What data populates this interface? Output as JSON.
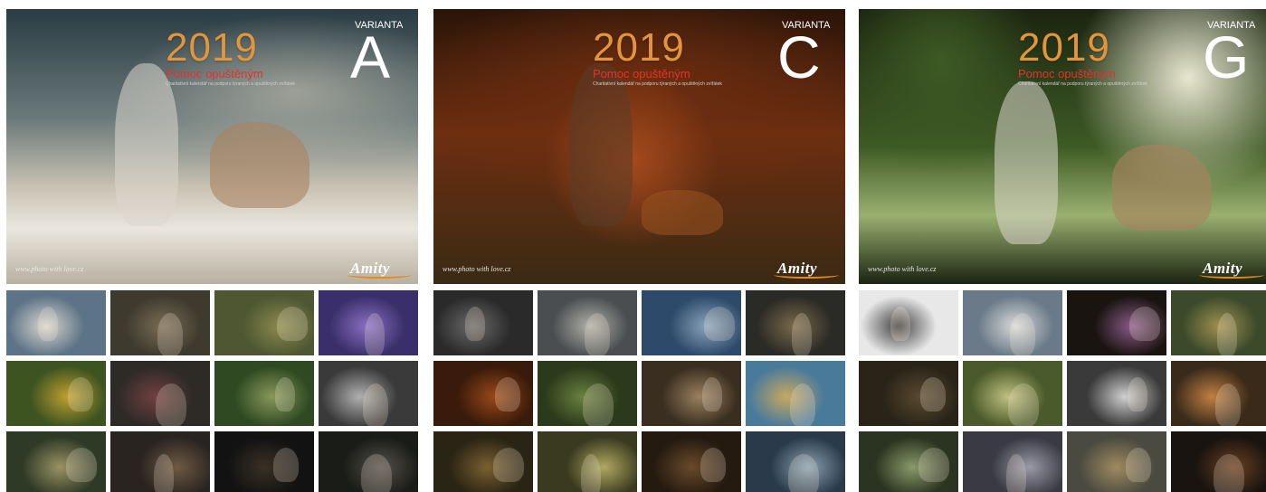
{
  "panels": [
    {
      "id": "a",
      "year": "2019",
      "subtitle": "Pomoc opuštěným",
      "tagline": "Charitativní kalendář na podporu týraných a opuštěných zvířátek",
      "variant_label": "VARIANTA",
      "variant_letter": "A",
      "signature": "www.photo with love.cz",
      "logo": "Amity",
      "cover_colors": [
        "#2a3c44",
        "#6b7a7a",
        "#c9c3b4",
        "#eae6de"
      ],
      "thumb_colors": [
        [
          "#5d7488",
          "#d9d6cc"
        ],
        [
          "#3e3a2e",
          "#7a6d55"
        ],
        [
          "#4e5732",
          "#8c8a4e"
        ],
        [
          "#3a2f6a",
          "#8a6fc2"
        ],
        [
          "#3e5420",
          "#c0a030"
        ],
        [
          "#2e2a26",
          "#704040"
        ],
        [
          "#2f4a22",
          "#88985a"
        ],
        [
          "#3a3a3a",
          "#b0b0b0"
        ],
        [
          "#2e3a26",
          "#9a9264"
        ],
        [
          "#2a2420",
          "#6e5a44"
        ],
        [
          "#121212",
          "#3a3024"
        ],
        [
          "#1a1c18",
          "#55504a"
        ]
      ]
    },
    {
      "id": "c",
      "year": "2019",
      "subtitle": "Pomoc opuštěným",
      "tagline": "Charitativní kalendář na podporu týraných a opuštěných zvířátek",
      "variant_label": "VARIANTA",
      "variant_letter": "C",
      "signature": "www.photo with love.cz",
      "logo": "Amity",
      "cover_colors": [
        "#2a1408",
        "#6e2e10",
        "#a44a1c",
        "#3a2a14"
      ],
      "thumb_colors": [
        [
          "#2a2a2a",
          "#6a6a6a"
        ],
        [
          "#4a4e50",
          "#b0b0a8"
        ],
        [
          "#2e4a6a",
          "#8aa4bc"
        ],
        [
          "#2a2a26",
          "#7a6a4a"
        ],
        [
          "#3a1a0a",
          "#9a4a1a"
        ],
        [
          "#2a3a1a",
          "#6a8040"
        ],
        [
          "#3a2e20",
          "#9a8060"
        ],
        [
          "#4a7a9a",
          "#c8a860"
        ],
        [
          "#2a2414",
          "#7a6030"
        ],
        [
          "#3a3a20",
          "#b0a860"
        ],
        [
          "#241a10",
          "#6a4a2a"
        ],
        [
          "#2a3a4a",
          "#8aa0b0"
        ]
      ]
    },
    {
      "id": "g",
      "year": "2019",
      "subtitle": "Pomoc opuštěným",
      "tagline": "Charitativní kalendář na podporu týraných a opuštěných zvířátek",
      "variant_label": "VARIANTA",
      "variant_letter": "G",
      "signature": "www.photo with love.cz",
      "logo": "Amity",
      "cover_colors": [
        "#1a2410",
        "#3e5a24",
        "#9ab070",
        "#e8e6d0"
      ],
      "thumb_colors": [
        [
          "#e8e8e8",
          "#404040"
        ],
        [
          "#6a7a88",
          "#dadada"
        ],
        [
          "#1a1410",
          "#8a5a8a"
        ],
        [
          "#3a4a2a",
          "#a09050"
        ],
        [
          "#2a2418",
          "#5a4a30"
        ],
        [
          "#4a5a2a",
          "#c0c080"
        ],
        [
          "#3a3a3a",
          "#d0d0d0"
        ],
        [
          "#3a2a1a",
          "#c08040"
        ],
        [
          "#2a3420",
          "#8a9a6a"
        ],
        [
          "#3a3a44",
          "#9a9aa8"
        ],
        [
          "#4a4a40",
          "#a08a60"
        ],
        [
          "#1a1410",
          "#6a4020"
        ]
      ]
    }
  ]
}
